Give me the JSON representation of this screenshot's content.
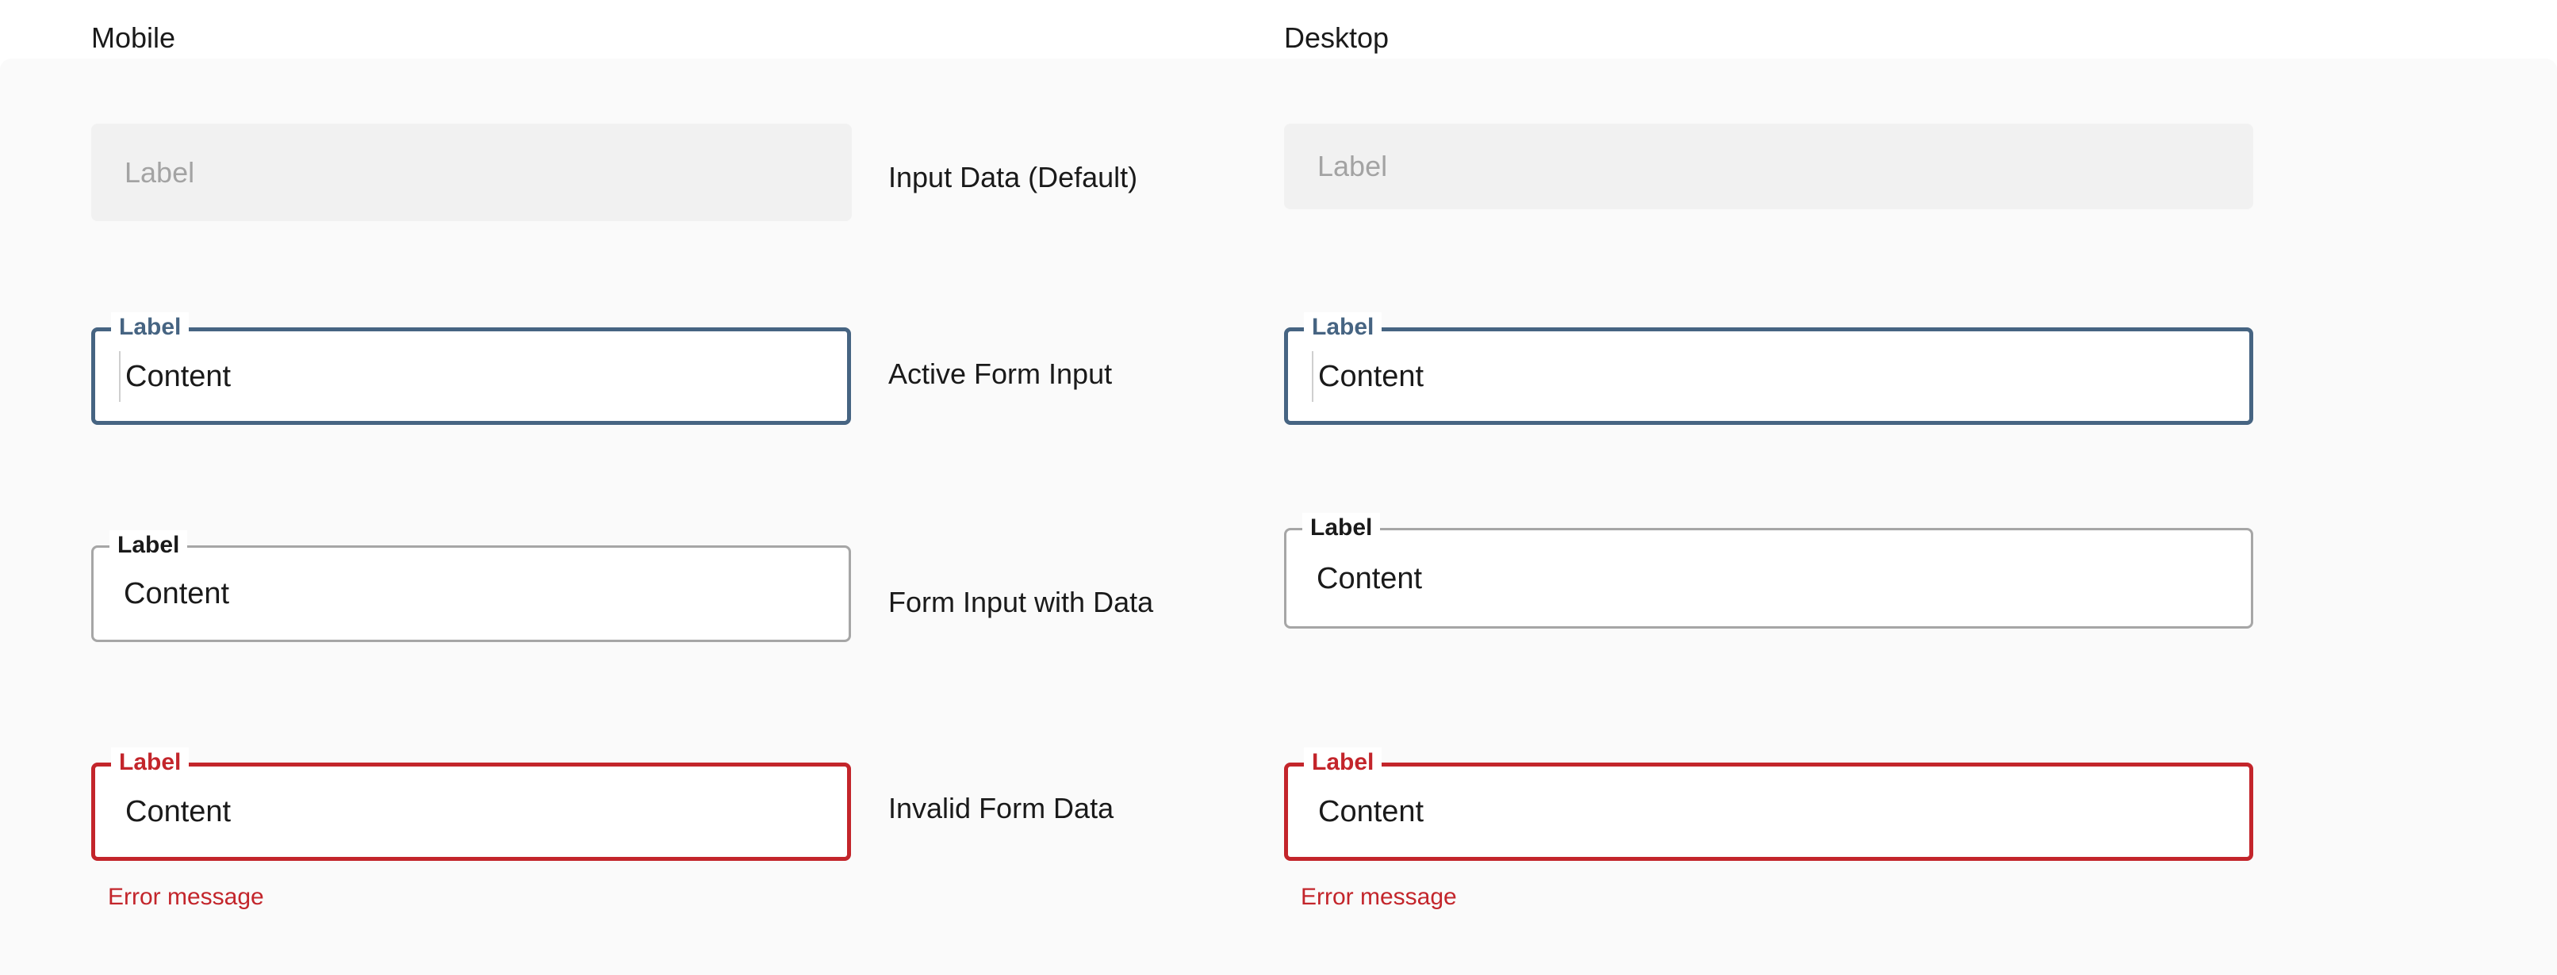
{
  "columns": {
    "mobile_title": "Mobile",
    "desktop_title": "Desktop"
  },
  "rows": {
    "default_label": "Input Data (Default)",
    "active_label": "Active Form Input",
    "filled_label": "Form Input with Data",
    "invalid_label": "Invalid Form Data"
  },
  "fields": {
    "label_text": "Label",
    "content_text": "Content",
    "error_text": "Error message"
  },
  "colors": {
    "active": "#466482",
    "invalid": "#c3252b",
    "filled_border": "#a6a6a6",
    "default_bg": "#f1f1f1",
    "placeholder": "#a3a3a3"
  }
}
